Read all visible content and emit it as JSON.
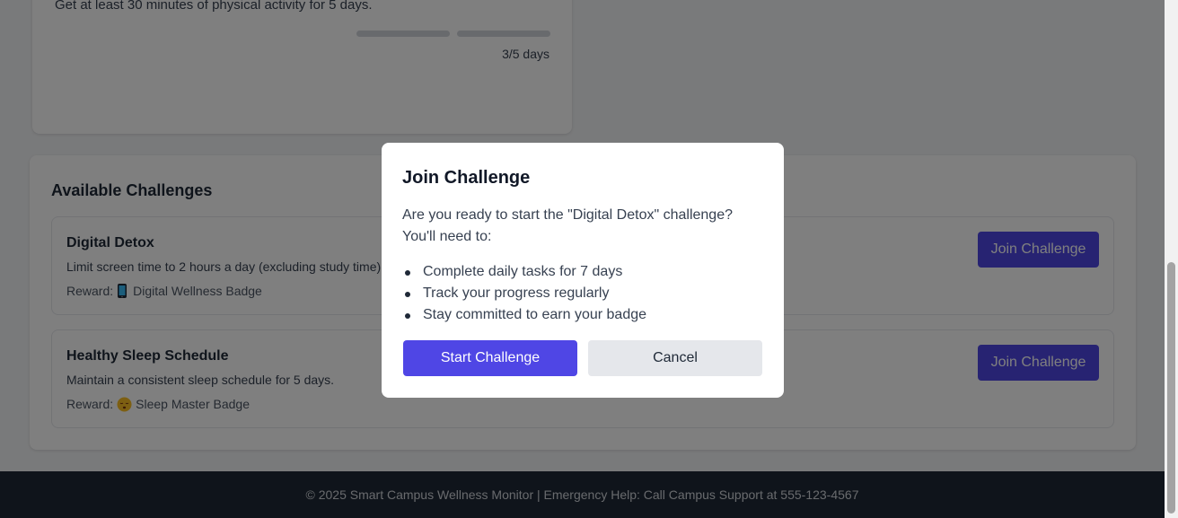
{
  "active_challenge": {
    "description": "Get at least 30 minutes of physical activity for 5 days.",
    "progress_text": "3/5 days",
    "progress_fraction": 0.6
  },
  "available": {
    "title": "Available Challenges",
    "challenges": [
      {
        "name": "Digital Detox",
        "description": "Limit screen time to 2 hours a day (excluding study time).",
        "reward_label": "Reward:",
        "reward_icon": "phone-icon",
        "reward": "Digital Wellness Badge",
        "button": "Join Challenge"
      },
      {
        "name": "Healthy Sleep Schedule",
        "description": "Maintain a consistent sleep schedule for 5 days.",
        "reward_label": "Reward:",
        "reward_icon": "sleeping-face-icon",
        "reward": "Sleep Master Badge",
        "button": "Join Challenge"
      }
    ]
  },
  "modal": {
    "title": "Join Challenge",
    "body": "Are you ready to start the \"Digital Detox\" challenge? You'll need to:",
    "items": [
      "Complete daily tasks for 7 days",
      "Track your progress regularly",
      "Stay committed to earn your badge"
    ],
    "start_button": "Start Challenge",
    "cancel_button": "Cancel"
  },
  "footer": {
    "text": "© 2025 Smart Campus Wellness Monitor | Emergency Help: Call Campus Support at 555-123-4567"
  },
  "colors": {
    "primary": "#4f46e5",
    "overlay": "rgba(0,0,0,0.5)",
    "footer_bg": "#1f2937"
  }
}
